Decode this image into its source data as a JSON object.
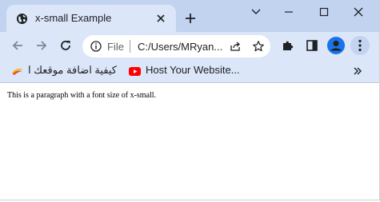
{
  "tab": {
    "title": "x-small Example",
    "favicon": "globe-icon"
  },
  "address_bar": {
    "scheme_label": "File",
    "url": "C:/Users/MRyan..."
  },
  "bookmarks": [
    {
      "label": "كيفية اضافة موقعك ا...",
      "icon": "swoosh-icon"
    },
    {
      "label": "Host Your Website...",
      "icon": "youtube-icon"
    }
  ],
  "page": {
    "paragraph": "This is a paragraph with a font size of x-small."
  },
  "colors": {
    "titlebar": "#c2d3ef",
    "tab_active": "#dbe6f8",
    "toolbar": "#dbe6f8",
    "avatar": "#1a73e8",
    "youtube_red": "#ff0000"
  }
}
